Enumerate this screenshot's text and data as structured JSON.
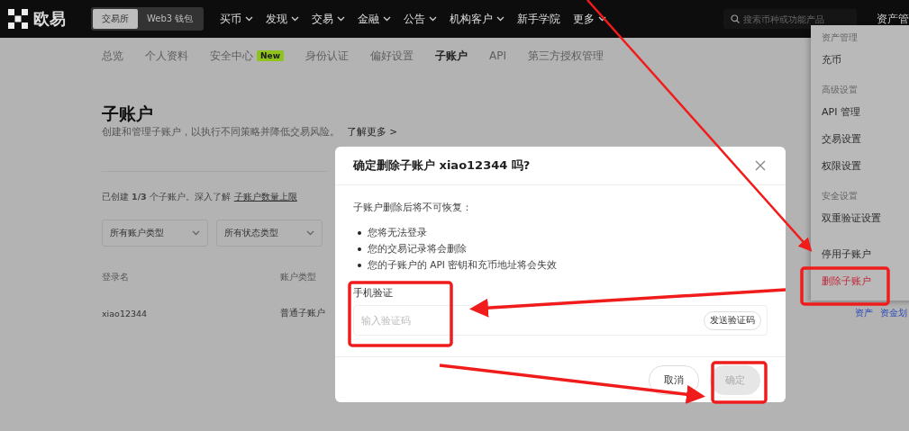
{
  "header": {
    "logo": "欧易",
    "switch": [
      {
        "label": "交易所",
        "selected": true
      },
      {
        "label": "Web3 钱包",
        "selected": false
      }
    ],
    "nav": [
      {
        "label": "买币",
        "caret": true
      },
      {
        "label": "发现",
        "caret": true
      },
      {
        "label": "交易",
        "caret": true
      },
      {
        "label": "金融",
        "caret": true
      },
      {
        "label": "公告",
        "caret": true
      },
      {
        "label": "机构客户",
        "caret": true
      },
      {
        "label": "新手学院",
        "caret": false
      },
      {
        "label": "更多",
        "caret": true
      }
    ],
    "search": {
      "placeholder": "搜索币种或功能产品"
    },
    "assets": "资产管"
  },
  "tabs": [
    {
      "label": "总览",
      "selected": false
    },
    {
      "label": "个人资料",
      "selected": false
    },
    {
      "label": "安全中心",
      "badge": "New",
      "selected": false
    },
    {
      "label": "身份认证",
      "selected": false
    },
    {
      "label": "偏好设置",
      "selected": false
    },
    {
      "label": "子账户",
      "selected": true
    },
    {
      "label": "API",
      "selected": false
    },
    {
      "label": "第三方授权管理",
      "selected": false
    }
  ],
  "page": {
    "title": "子账户",
    "description": "创建和管理子账户，以执行不同策略并降低交易风险。",
    "learn_more": "了解更多 >",
    "count_note": "已创建 **1/3** 个子账户。深入了解",
    "count_link": "子账户数量上限",
    "filters": [
      "所有账户类型",
      "所有状态类型"
    ],
    "table": {
      "columns": [
        "登录名",
        "账户类型"
      ],
      "rows": [
        {
          "cells": [
            "xiao12344",
            "普通子账户"
          ],
          "actions": [
            "资产",
            "资金划"
          ]
        }
      ]
    }
  },
  "menu": {
    "sections": [
      {
        "heading": "资产管理",
        "items": [
          {
            "label": "充币",
            "danger": false
          }
        ]
      },
      {
        "heading": "高级设置",
        "items": [
          {
            "label": "API 管理",
            "danger": false
          },
          {
            "label": "交易设置",
            "danger": false
          },
          {
            "label": "权限设置",
            "danger": false
          }
        ]
      },
      {
        "heading": "安全设置",
        "items": [
          {
            "label": "双重验证设置",
            "danger": false
          }
        ]
      },
      {
        "items": [
          {
            "label": "停用子账户",
            "danger": false
          },
          {
            "label": "删除子账户",
            "danger": true
          }
        ]
      }
    ]
  },
  "dialog": {
    "title": "确定删除子账户 xiao12344 吗?",
    "warning": "子账户删除后将不可恢复：",
    "bullets": [
      "您将无法登录",
      "您的交易记录将会删除",
      "您的子账户的 API 密钥和充币地址将会失效"
    ],
    "field_label": "手机验证",
    "field": {
      "placeholder": "输入验证码"
    },
    "send_code": "发送验证码",
    "buttons": [
      {
        "label": "取消",
        "kind": "secondary",
        "disabled": false
      },
      {
        "label": "确定",
        "kind": "primary",
        "disabled": true
      }
    ]
  }
}
